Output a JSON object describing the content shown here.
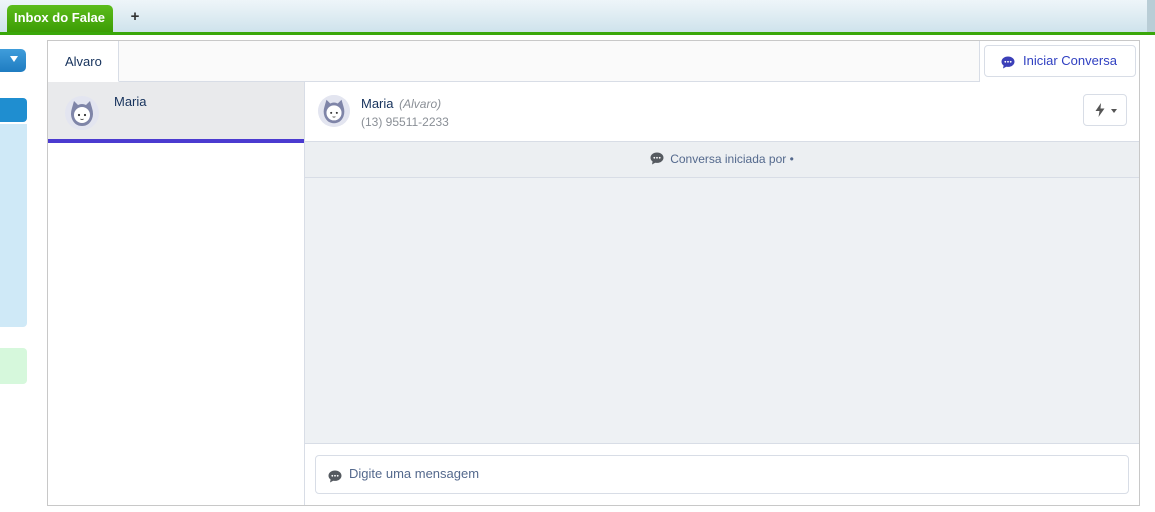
{
  "tabs": {
    "active_label": "Inbox do Falae",
    "add_label": "+"
  },
  "header": {
    "owner_tab": "Alvaro",
    "start_button": "Iniciar Conversa"
  },
  "contacts": [
    {
      "name": "Maria",
      "selected": true
    }
  ],
  "conversation": {
    "contact_name": "Maria",
    "owner": "(Alvaro)",
    "phone": "(13) 95511-2233",
    "started_text": "Conversa iniciada por •"
  },
  "composer": {
    "placeholder": "Digite uma mensagem"
  },
  "colors": {
    "tab_green": "#3c9d05",
    "accent_purple": "#4b3bd0",
    "link_blue": "#2f3fc1"
  }
}
